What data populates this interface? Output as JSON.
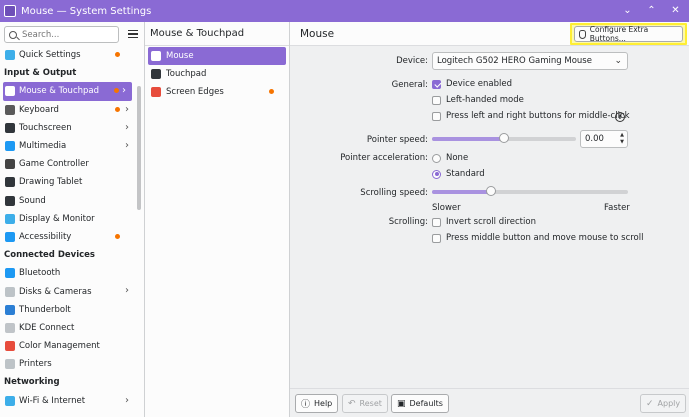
{
  "window": {
    "title": "Mouse — System Settings",
    "controls": [
      "⌄",
      "⌃",
      "✕"
    ]
  },
  "sidebar": {
    "search_placeholder": "Search...",
    "items": [
      {
        "label": "Quick Settings",
        "icon": "quick-settings-icon",
        "color": "#3daee9",
        "dot": true,
        "chevron": false
      },
      {
        "header": "Input & Output"
      },
      {
        "label": "Mouse & Touchpad",
        "icon": "mouse-icon",
        "color": "#ffffff",
        "dot": true,
        "chevron": true,
        "active": true
      },
      {
        "label": "Keyboard",
        "icon": "keyboard-icon",
        "color": "#5a5a5a",
        "dot": true,
        "chevron": true
      },
      {
        "label": "Touchscreen",
        "icon": "touchscreen-icon",
        "color": "#31363b",
        "dot": false,
        "chevron": true
      },
      {
        "label": "Multimedia",
        "icon": "multimedia-icon",
        "color": "#1d99f3",
        "dot": false,
        "chevron": true
      },
      {
        "label": "Game Controller",
        "icon": "gamepad-icon",
        "color": "#444444",
        "dot": false,
        "chevron": false
      },
      {
        "label": "Drawing Tablet",
        "icon": "tablet-icon",
        "color": "#31363b",
        "dot": false,
        "chevron": false
      },
      {
        "label": "Sound",
        "icon": "sound-icon",
        "color": "#31363b",
        "dot": false,
        "chevron": false
      },
      {
        "label": "Display & Monitor",
        "icon": "display-icon",
        "color": "#3daee9",
        "dot": false,
        "chevron": false
      },
      {
        "label": "Accessibility",
        "icon": "accessibility-icon",
        "color": "#1d99f3",
        "dot": true,
        "chevron": false
      },
      {
        "header": "Connected Devices"
      },
      {
        "label": "Bluetooth",
        "icon": "bluetooth-icon",
        "color": "#1d99f3",
        "dot": false,
        "chevron": false
      },
      {
        "label": "Disks & Cameras",
        "icon": "disks-icon",
        "color": "#bdc3c7",
        "dot": false,
        "chevron": true
      },
      {
        "label": "Thunderbolt",
        "icon": "thunderbolt-icon",
        "color": "#2c7fd4",
        "dot": false,
        "chevron": false
      },
      {
        "label": "KDE Connect",
        "icon": "kde-connect-icon",
        "color": "#c0c4c8",
        "dot": false,
        "chevron": false
      },
      {
        "label": "Color Management",
        "icon": "color-management-icon",
        "color": "#e74c3c",
        "dot": false,
        "chevron": false
      },
      {
        "label": "Printers",
        "icon": "printer-icon",
        "color": "#bdc3c7",
        "dot": false,
        "chevron": false
      },
      {
        "header": "Networking"
      },
      {
        "label": "Wi-Fi & Internet",
        "icon": "wifi-icon",
        "color": "#3daee9",
        "dot": false,
        "chevron": true
      }
    ]
  },
  "middle": {
    "title": "Mouse & Touchpad",
    "items": [
      {
        "label": "Mouse",
        "icon": "mouse-icon",
        "color": "#ffffff",
        "active": true,
        "dot": false
      },
      {
        "label": "Touchpad",
        "icon": "touchpad-icon",
        "color": "#31363b",
        "active": false,
        "dot": false
      },
      {
        "label": "Screen Edges",
        "icon": "screen-edges-icon",
        "color": "#e74c3c",
        "active": false,
        "dot": true
      }
    ]
  },
  "main": {
    "title": "Mouse",
    "configure_button": "Configure Extra Buttons...",
    "device_label": "Device:",
    "device_value": "Logitech G502 HERO Gaming Mouse",
    "general_label": "General:",
    "device_enabled": "Device enabled",
    "left_handed": "Left-handed mode",
    "middle_click": "Press left and right buttons for middle-click",
    "pointer_speed_label": "Pointer speed:",
    "pointer_speed_value": "0.00",
    "pointer_speed_fraction": 0.5,
    "pointer_accel_label": "Pointer acceleration:",
    "accel_none": "None",
    "accel_standard": "Standard",
    "scrolling_speed_label": "Scrolling speed:",
    "scrolling_speed_fraction": 0.3,
    "slower": "Slower",
    "faster": "Faster",
    "scrolling_label": "Scrolling:",
    "invert_scroll": "Invert scroll direction",
    "middle_scroll": "Press middle button and move mouse to scroll"
  },
  "footer": {
    "help": "Help",
    "reset": "Reset",
    "defaults": "Defaults",
    "apply": "Apply"
  },
  "colors": {
    "accent": "#8a6ad4",
    "highlight_border": "#ffee33",
    "notification_dot": "#f67400"
  }
}
